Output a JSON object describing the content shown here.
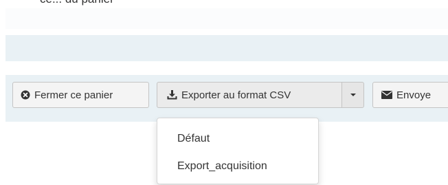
{
  "header": {
    "title_partial": "ce... du panier"
  },
  "toolbar": {
    "close_label": "Fermer ce panier",
    "export_label": "Exporter au format CSV",
    "send_label": "Envoye"
  },
  "export_menu": {
    "items": [
      {
        "label": "Défaut"
      },
      {
        "label": "Export_acquisition"
      }
    ]
  },
  "colors": {
    "band": "#e9f1f5",
    "button": "#f4f4f4",
    "border": "#c4c4c4"
  },
  "icons": {
    "close": "times-circle-icon",
    "export": "download-icon",
    "caret": "caret-down-icon",
    "send": "envelope-icon"
  }
}
